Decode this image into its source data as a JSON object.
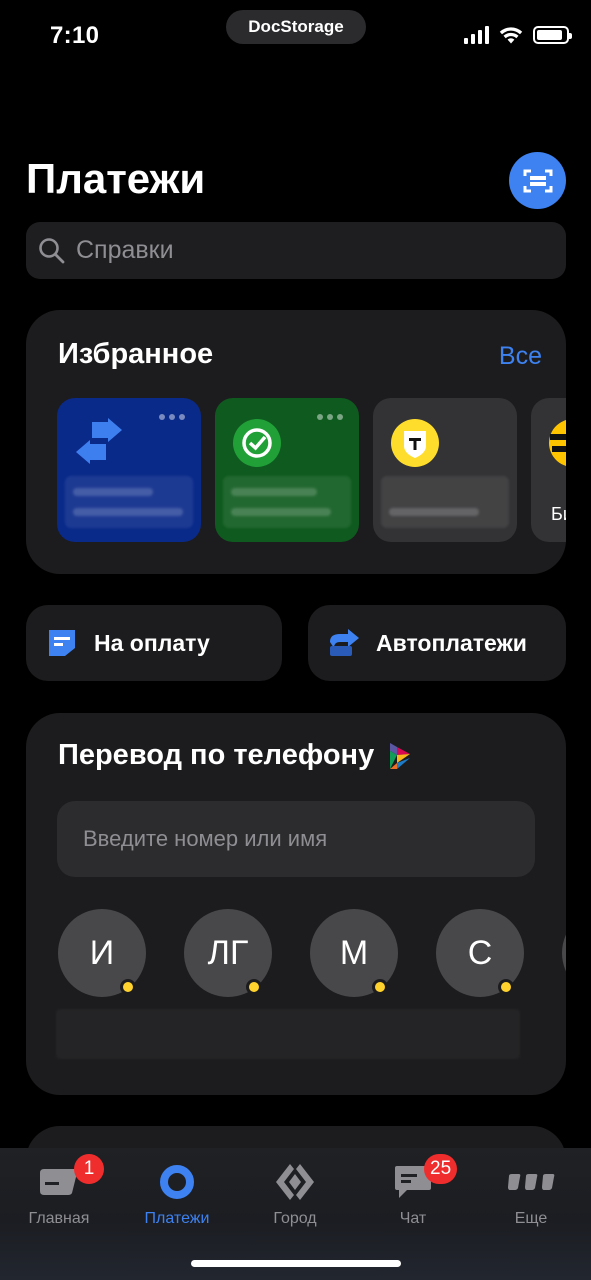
{
  "status_bar": {
    "time": "7:10",
    "app_pill": "DocStorage",
    "battery_level": 0.9
  },
  "header": {
    "title": "Платежи",
    "scan_icon": "qr-scan-icon"
  },
  "search": {
    "placeholder": "Справки"
  },
  "favorites": {
    "title": "Избранное",
    "all_link": "Все",
    "tiles": [
      {
        "icon": "transfer-arrows-icon",
        "color": "#0a2a8a"
      },
      {
        "icon": "sber-check-icon",
        "color": "#0f5b1f"
      },
      {
        "icon": "tinkoff-shield-icon",
        "color": "#333335"
      },
      {
        "icon": "beeline-icon",
        "color": "#333335",
        "label": "Би"
      }
    ]
  },
  "actions": [
    {
      "label": "На оплату",
      "icon": "invoice-icon"
    },
    {
      "label": "Автоплатежи",
      "icon": "autopay-icon"
    }
  ],
  "transfer": {
    "title": "Перевод по телефону",
    "sbp_icon": "sbp-logo-icon",
    "input_placeholder": "Введите номер или имя",
    "contacts": [
      "И",
      "ЛГ",
      "М",
      "С"
    ]
  },
  "tabbar": {
    "items": [
      {
        "label": "Главная",
        "icon": "home-card-icon",
        "badge": "1",
        "active": false
      },
      {
        "label": "Платежи",
        "icon": "payments-icon",
        "active": true
      },
      {
        "label": "Город",
        "icon": "city-icon",
        "active": false
      },
      {
        "label": "Чат",
        "icon": "chat-icon",
        "badge": "25",
        "active": false
      },
      {
        "label": "Еще",
        "icon": "more-icon",
        "active": false
      }
    ]
  },
  "colors": {
    "accent": "#3d82f0",
    "card": "#1c1c1e",
    "badge": "#ef2d2d",
    "online_dot": "#ffd22e"
  }
}
